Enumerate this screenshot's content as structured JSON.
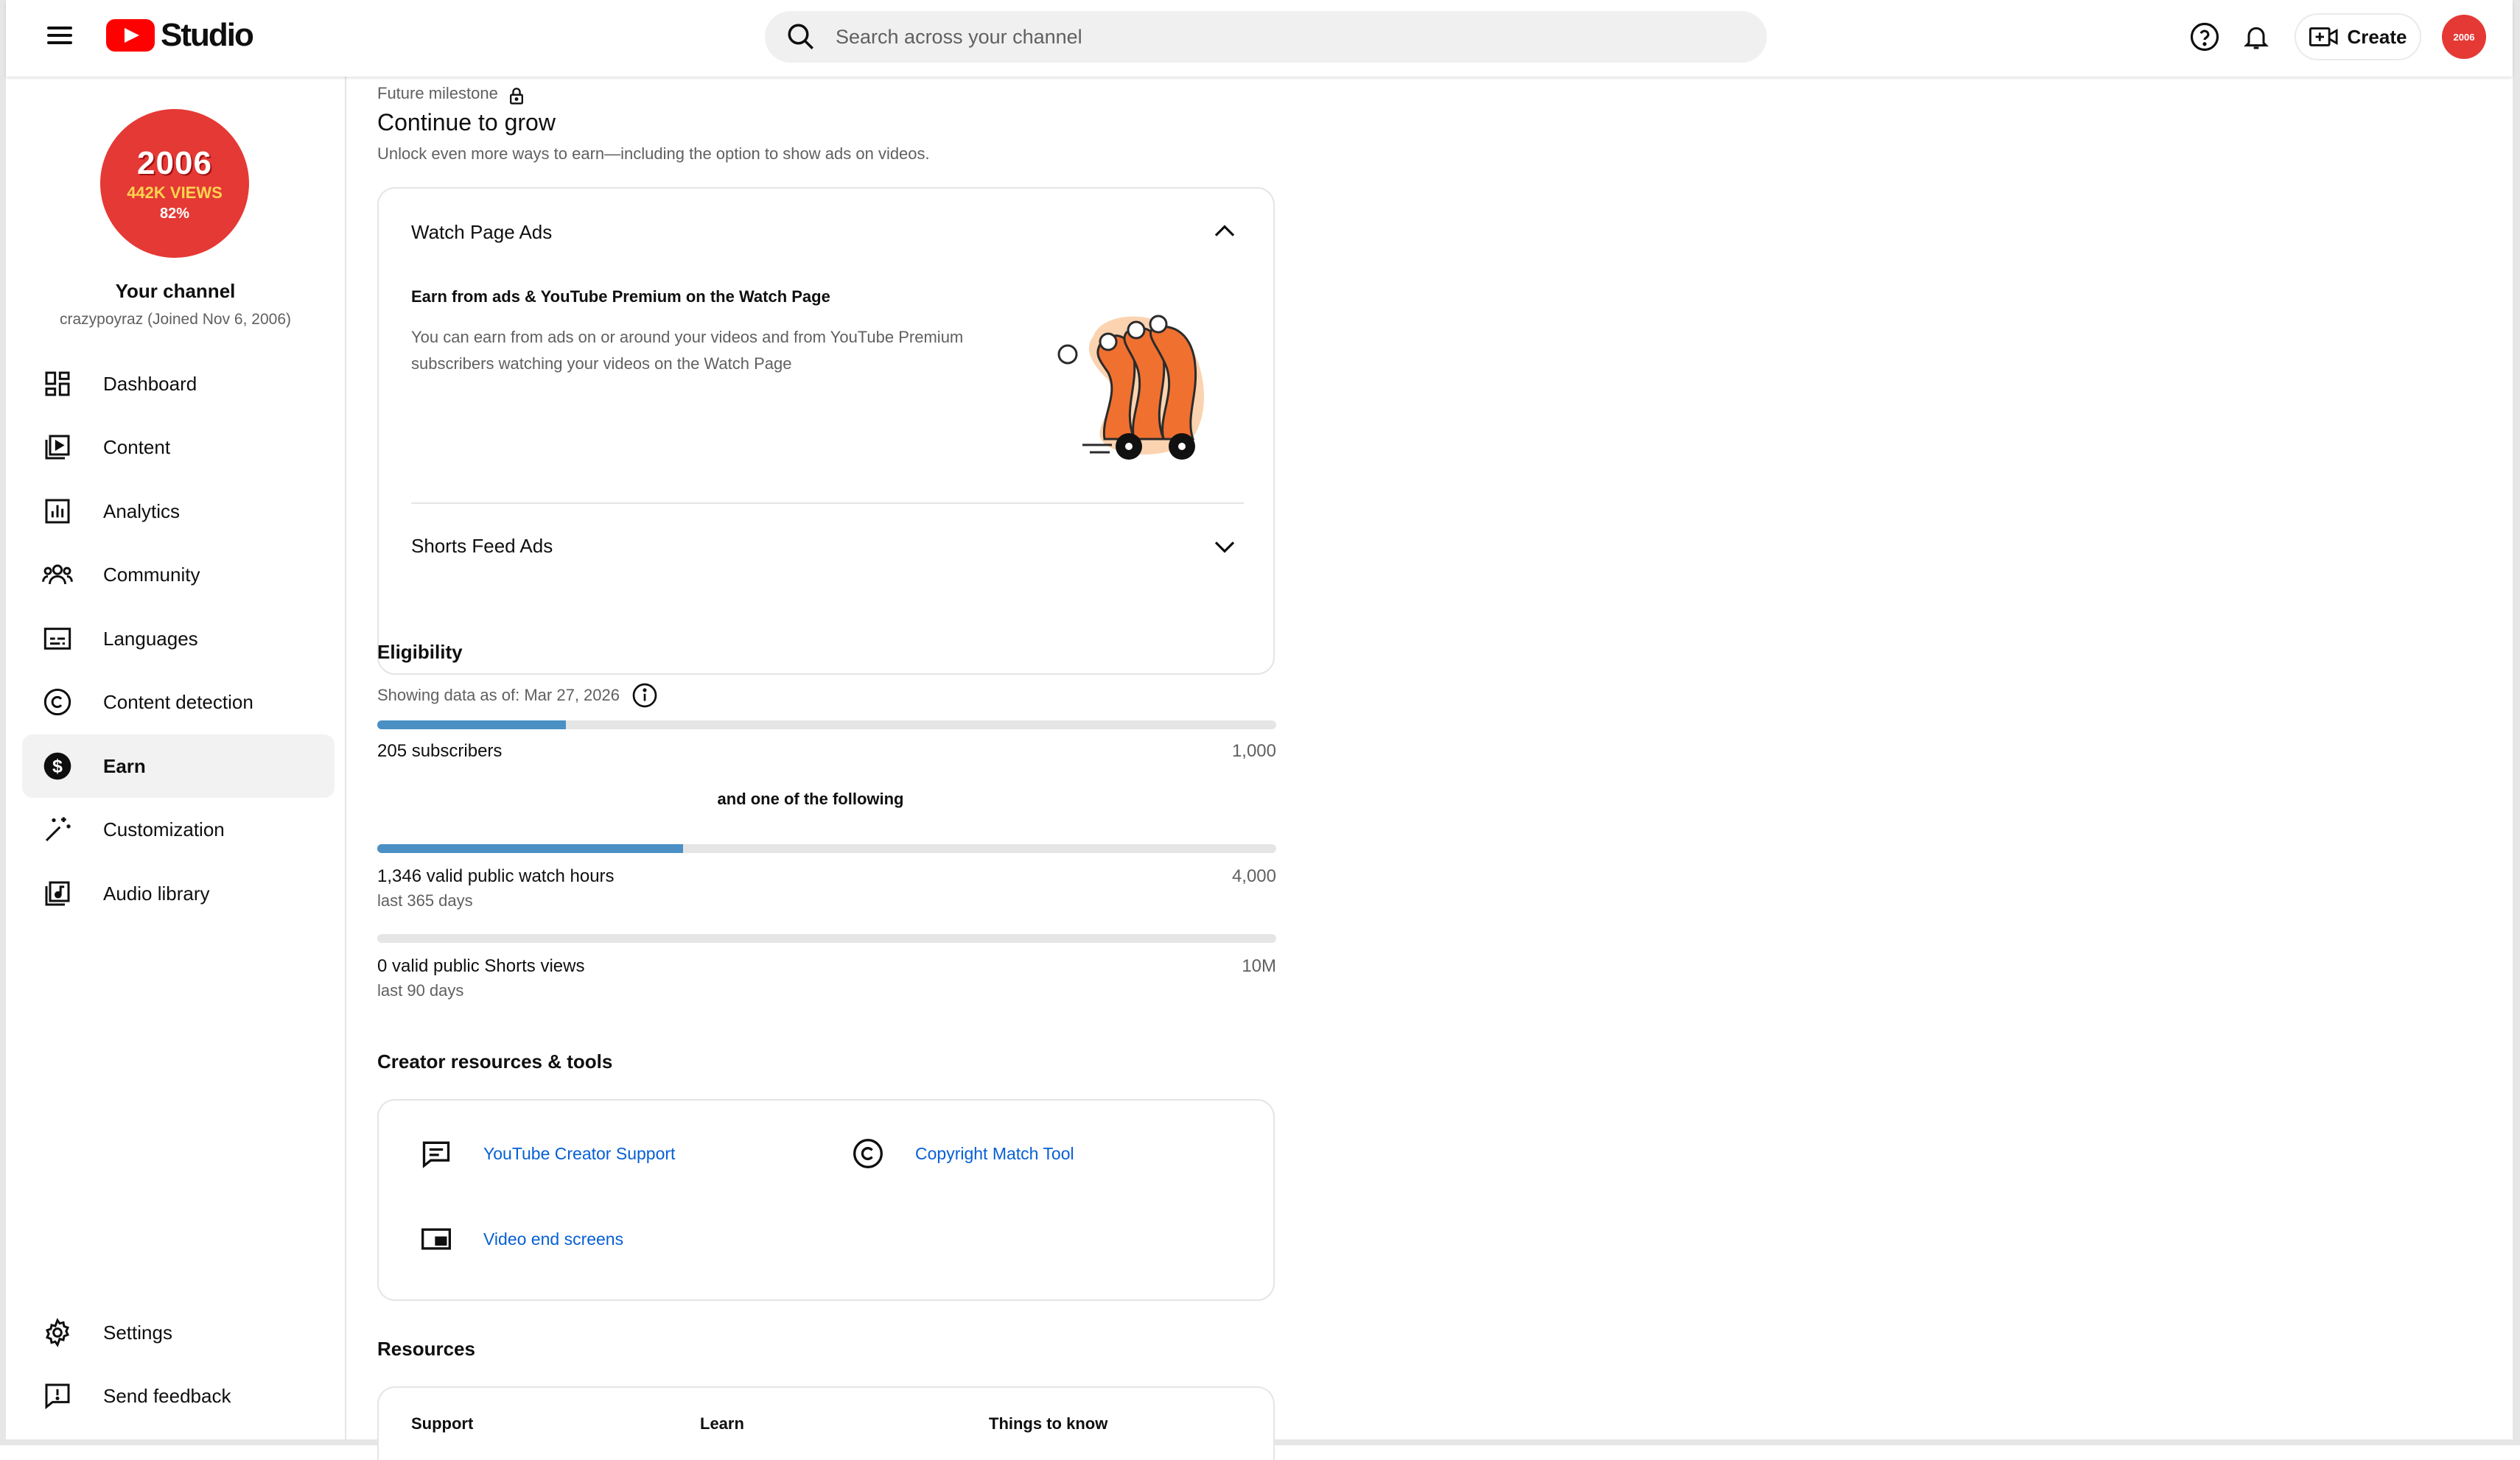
{
  "header": {
    "app_name": "Studio",
    "search_placeholder": "Search across your channel",
    "create_label": "Create",
    "avatar_text": "2006"
  },
  "sidebar": {
    "channel_avatar": {
      "year": "2006",
      "views": "442K VIEWS",
      "percent": "82%"
    },
    "channel_title": "Your channel",
    "channel_sub": "crazypoyraz (Joined Nov 6, 2006)",
    "items": [
      {
        "label": "Dashboard",
        "icon": "dashboard-icon"
      },
      {
        "label": "Content",
        "icon": "content-icon"
      },
      {
        "label": "Analytics",
        "icon": "analytics-icon"
      },
      {
        "label": "Community",
        "icon": "community-icon"
      },
      {
        "label": "Languages",
        "icon": "subtitles-icon"
      },
      {
        "label": "Content detection",
        "icon": "copyright-icon"
      },
      {
        "label": "Earn",
        "icon": "dollar-icon",
        "active": true
      },
      {
        "label": "Customization",
        "icon": "magic-wand-icon"
      },
      {
        "label": "Audio library",
        "icon": "audio-library-icon"
      }
    ],
    "bottom_items": [
      {
        "label": "Settings",
        "icon": "gear-icon"
      },
      {
        "label": "Send feedback",
        "icon": "feedback-icon"
      }
    ]
  },
  "milestone": {
    "kicker": "Future milestone",
    "title": "Continue to grow",
    "description": "Unlock even more ways to earn—including the option to show ads on videos."
  },
  "ads_card": {
    "section1_title": "Watch Page Ads",
    "section1_heading": "Earn from ads & YouTube Premium on the Watch Page",
    "section1_body": "You can earn from ads on or around your videos and from YouTube Premium subscribers watching your videos on the Watch Page",
    "section2_title": "Shorts Feed Ads"
  },
  "eligibility": {
    "title": "Eligibility",
    "data_as_of": "Showing data as of: Mar 27, 2026",
    "subscribers": {
      "label": "205 subscribers",
      "target": "1,000",
      "fraction": 0.21
    },
    "connector": "and one of the following",
    "watch_hours": {
      "label": "1,346 valid public watch hours",
      "sub": "last 365 days",
      "target": "4,000",
      "fraction": 0.34
    },
    "shorts_views": {
      "label": "0 valid public Shorts views",
      "sub": "last 90 days",
      "target": "10M",
      "fraction": 0
    }
  },
  "creator_resources": {
    "title": "Creator resources & tools",
    "links": [
      {
        "label": "YouTube Creator Support",
        "icon": "chat-icon"
      },
      {
        "label": "Copyright Match Tool",
        "icon": "copyright-icon"
      },
      {
        "label": "Video end screens",
        "icon": "end-screen-icon"
      }
    ]
  },
  "resources": {
    "title": "Resources",
    "columns": [
      "Support",
      "Learn",
      "Things to know"
    ]
  }
}
